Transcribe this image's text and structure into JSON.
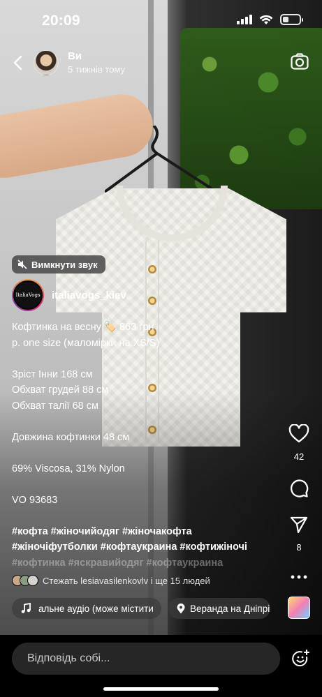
{
  "status_bar": {
    "time": "20:09"
  },
  "header": {
    "user_name": "Ви",
    "posted_ago": "5 тижнів тому"
  },
  "media": {
    "mute_label": "Вимкнути звук"
  },
  "post": {
    "author_username": "italiavogs_kiev",
    "author_logo_text": "ItaliaVogs",
    "caption_lines": [
      "Кофтинка на весну 🏷️ 863 грн",
      "р. one size (маломірки на XS/S)",
      "",
      "Зріст Інни 168 см",
      "Обхват грудей 88 см",
      "Обхват талії 68 см",
      "",
      "Довжина кофтинки 48 см",
      "",
      "69% Viscosa, 31% Nylon",
      "",
      "VO 93683",
      ""
    ],
    "hashtag_lines": [
      "#кофта #жіночийодяг #жіночакофта",
      "#жіночіфутболки #кофтаукраина #кофтижіночі",
      "#кофтинка #яскравийодяг #кофтаукраина"
    ]
  },
  "actions": {
    "likes_count": "42",
    "shares_count": "8"
  },
  "followers_line": "Стежать lesiavasilenkovlv і ще 15 людей",
  "audio_chip": "альне аудіо  (може містити",
  "location_chip": "Веранда на Дніпрі",
  "reply": {
    "placeholder": "Відповідь собі..."
  },
  "colors": {
    "background": "#000000",
    "input_bg": "#262626",
    "accent_ring_start": "#f5a623",
    "accent_ring_end": "#833ab4"
  }
}
